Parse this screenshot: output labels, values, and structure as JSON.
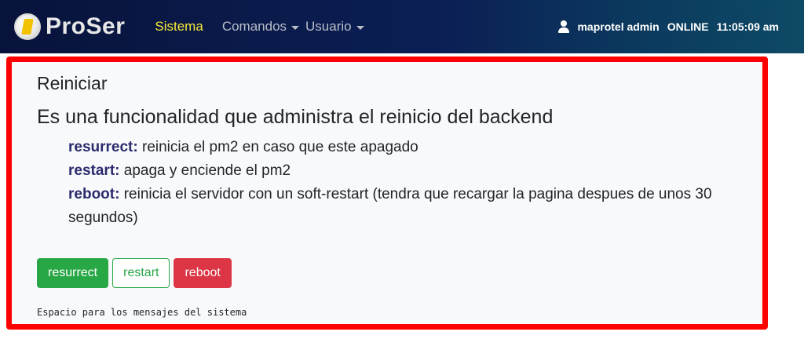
{
  "brand": {
    "name": "ProSer"
  },
  "nav": {
    "items": [
      {
        "label": "Sistema",
        "active": true
      },
      {
        "label": "Comandos",
        "dropdown": true
      },
      {
        "label": "Usuario",
        "dropdown": true
      }
    ]
  },
  "status": {
    "user": "maprotel admin",
    "connection": "ONLINE",
    "time": "11:05:09 am"
  },
  "content": {
    "title": "Reiniciar",
    "description": "Es una funcionalidad que administra el reinicio del backend",
    "items": [
      {
        "key": "resurrect:",
        "text": " reinicia el pm2 en caso que este apagado"
      },
      {
        "key": "restart:",
        "text": " apaga y enciende el pm2"
      },
      {
        "key": "reboot:",
        "text": " reinicia el servidor con un soft-restart (tendra que recargar la pagina despues de unos 30 segundos)"
      }
    ],
    "buttons": {
      "resurrect": "resurrect",
      "restart": "restart",
      "reboot": "reboot"
    },
    "message": "Espacio para los mensajes del sistema"
  },
  "colors": {
    "highlight_border": "#ff0000",
    "nav_active": "#f7e93a",
    "success": "#28a745",
    "danger": "#dc3545"
  }
}
